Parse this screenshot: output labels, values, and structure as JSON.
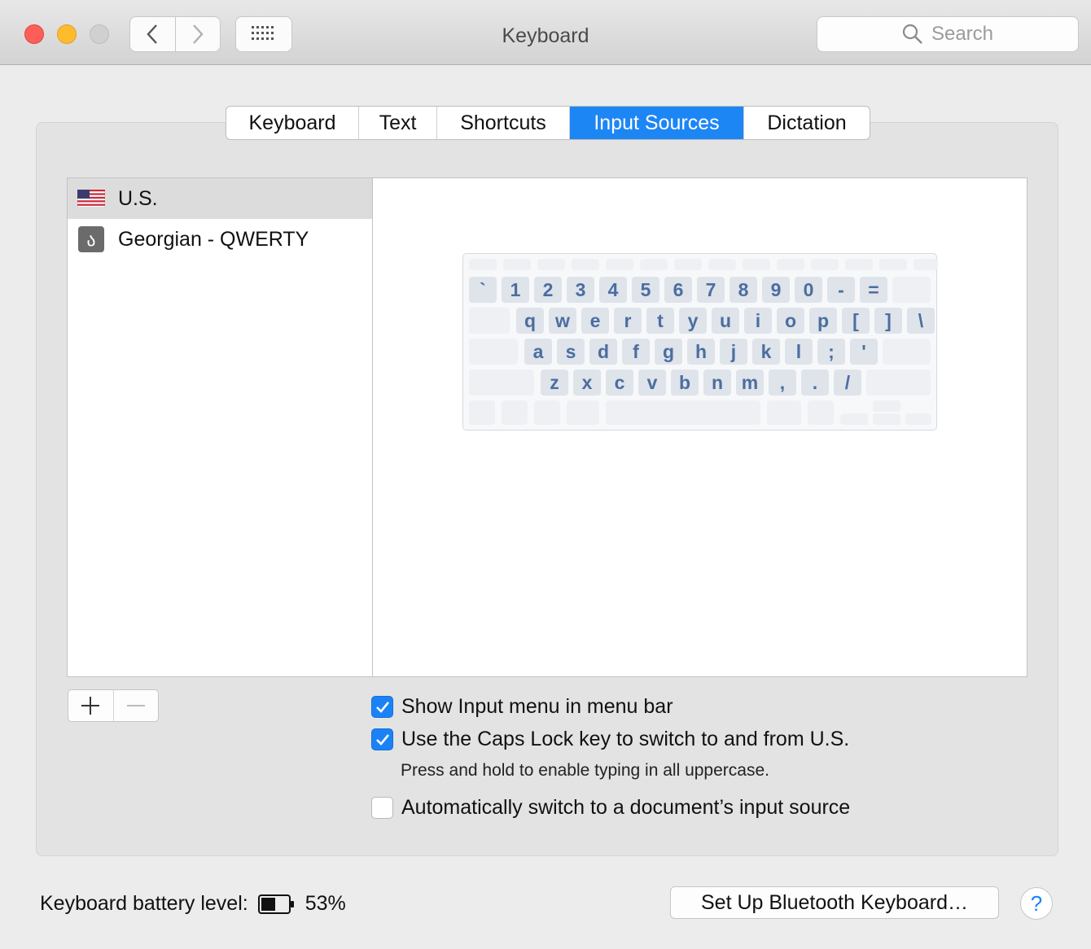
{
  "window": {
    "title": "Keyboard"
  },
  "search": {
    "placeholder": "Search"
  },
  "tabs": [
    {
      "label": "Keyboard",
      "active": false
    },
    {
      "label": "Text",
      "active": false
    },
    {
      "label": "Shortcuts",
      "active": false
    },
    {
      "label": "Input Sources",
      "active": true
    },
    {
      "label": "Dictation",
      "active": false
    }
  ],
  "sources": [
    {
      "label": "U.S.",
      "icon": "us-flag-icon",
      "selected": true
    },
    {
      "label": "Georgian - QWERTY",
      "icon": "georgian-letter-icon",
      "selected": false
    }
  ],
  "keyboard_preview": {
    "rows": [
      [
        "`",
        "1",
        "2",
        "3",
        "4",
        "5",
        "6",
        "7",
        "8",
        "9",
        "0",
        "-",
        "="
      ],
      [
        "q",
        "w",
        "e",
        "r",
        "t",
        "y",
        "u",
        "i",
        "o",
        "p",
        "[",
        "]",
        "\\"
      ],
      [
        "a",
        "s",
        "d",
        "f",
        "g",
        "h",
        "j",
        "k",
        "l",
        ";",
        "'"
      ],
      [
        "z",
        "x",
        "c",
        "v",
        "b",
        "n",
        "m",
        ",",
        ".",
        "/"
      ]
    ]
  },
  "list_buttons": {
    "add": "+",
    "remove": "—"
  },
  "options": {
    "show_input_menu": {
      "label": "Show Input menu in menu bar",
      "checked": true
    },
    "caps_lock": {
      "label": "Use the Caps Lock key to switch to and from U.S.",
      "checked": true,
      "hint": "Press and hold to enable typing in all uppercase."
    },
    "auto_switch": {
      "label": "Automatically switch to a document’s input source",
      "checked": false
    }
  },
  "battery": {
    "label": "Keyboard battery level:",
    "value": "53%",
    "level": 0.53
  },
  "bluetooth_button": {
    "label": "Set Up Bluetooth Keyboard…"
  },
  "help_button": {
    "label": "?"
  },
  "colors": {
    "accent": "#1d86f5",
    "key_text": "#4a6ea0"
  }
}
